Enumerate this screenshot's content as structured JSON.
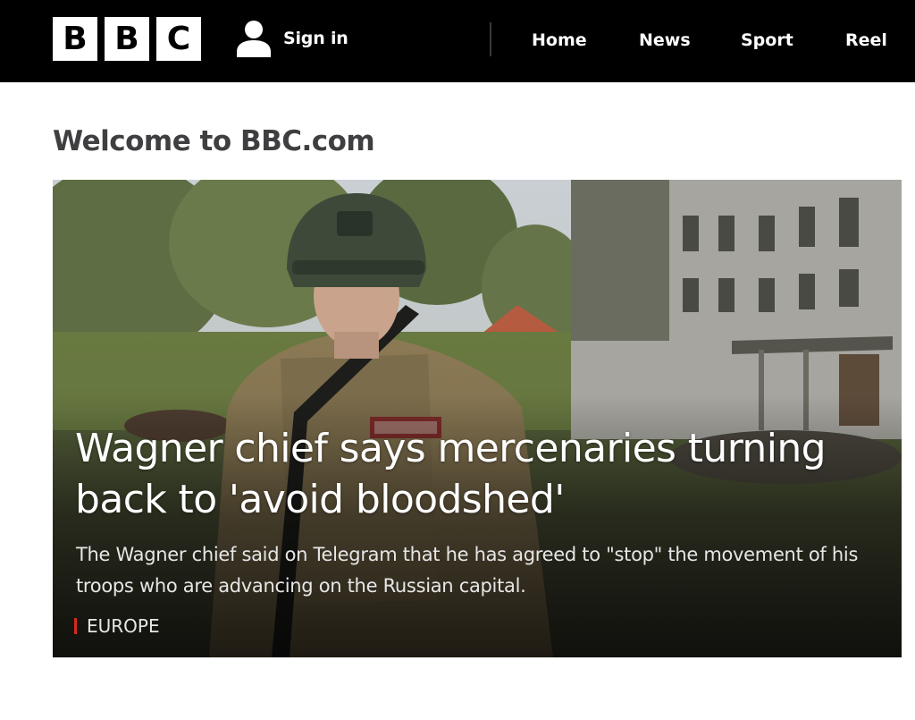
{
  "header": {
    "logo": [
      "B",
      "B",
      "C"
    ],
    "signin_icon": "user-icon",
    "signin_label": "Sign in",
    "nav": [
      "Home",
      "News",
      "Sport",
      "Reel"
    ]
  },
  "main": {
    "title": "Welcome to BBC.com",
    "top_story": {
      "headline": "Wagner chief says mercenaries turning back to 'avoid bloodshed'",
      "summary": "The Wagner chief said on Telegram that he has agreed to \"stop\" the movement of his troops who are advancing on the Russian capital.",
      "tag": "EUROPE",
      "tag_color": "#d52b1e"
    }
  },
  "colors": {
    "header_bg": "#000000",
    "title_text": "#3f3f42",
    "page_bg": "#ffffff"
  }
}
